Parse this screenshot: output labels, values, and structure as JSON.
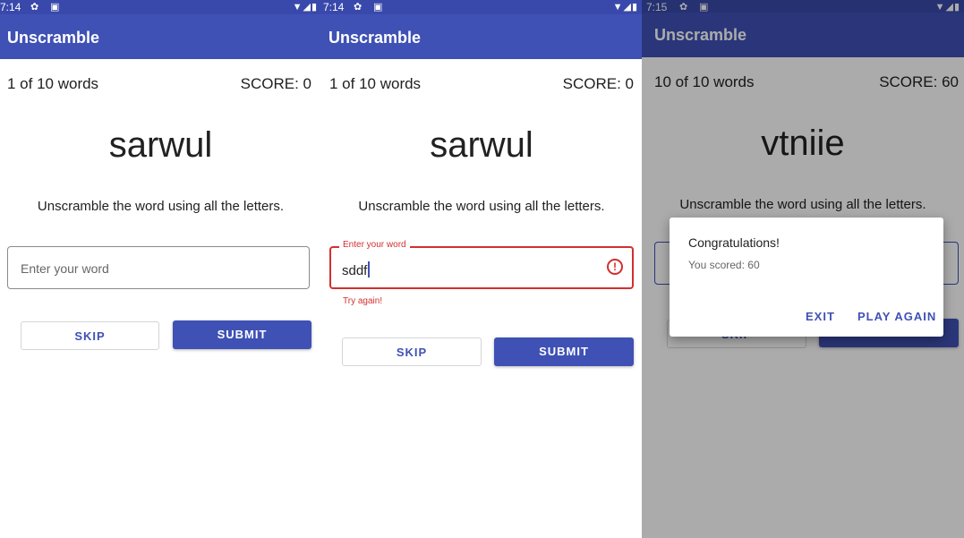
{
  "colors": {
    "primary": "#3f51b5",
    "primary_dark": "#3949ab",
    "error": "#d32f2f"
  },
  "screen1": {
    "status": {
      "time": "7:14"
    },
    "app_title": "Unscramble",
    "progress": "1 of 10 words",
    "score": "SCORE: 0",
    "scrambled_word": "sarwul",
    "instructions": "Unscramble the word using all the letters.",
    "input": {
      "placeholder": "Enter your word",
      "value": ""
    },
    "skip_label": "SKIP",
    "submit_label": "SUBMIT"
  },
  "screen2": {
    "status": {
      "time": "7:14"
    },
    "app_title": "Unscramble",
    "progress": "1 of 10 words",
    "score": "SCORE: 0",
    "scrambled_word": "sarwul",
    "instructions": "Unscramble the word using all the letters.",
    "input": {
      "label": "Enter your word",
      "value": "sddf",
      "error_text": "Try again!"
    },
    "skip_label": "SKIP",
    "submit_label": "SUBMIT"
  },
  "screen3": {
    "status": {
      "time": "7:15"
    },
    "app_title": "Unscramble",
    "progress": "10 of 10 words",
    "score": "SCORE: 60",
    "scrambled_word": "vtniie",
    "instructions": "Unscramble the word using all the letters.",
    "skip_label": "SKIP",
    "submit_label": "SUBMIT",
    "dialog": {
      "title": "Congratulations!",
      "message": "You scored: 60",
      "exit_label": "EXIT",
      "play_again_label": "PLAY AGAIN"
    }
  }
}
